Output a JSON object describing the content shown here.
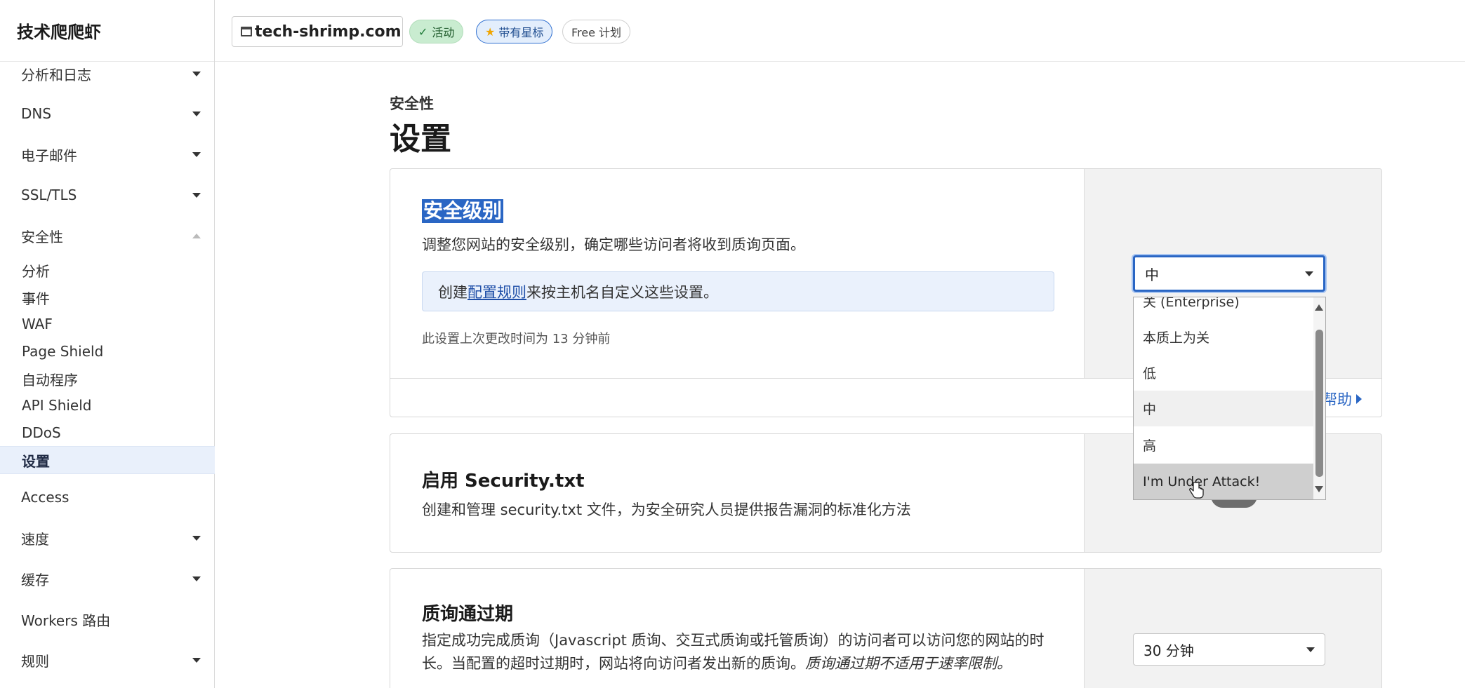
{
  "sidebar": {
    "brand": "技术爬爬虾",
    "groups": [
      {
        "label": "分析和日志",
        "expanded": false
      },
      {
        "label": "DNS",
        "expanded": false
      },
      {
        "label": "电子邮件",
        "expanded": false
      },
      {
        "label": "SSL/TLS",
        "expanded": false
      },
      {
        "label": "安全性",
        "expanded": true
      }
    ],
    "security_items": [
      "分析",
      "事件",
      "WAF",
      "Page Shield",
      "自动程序",
      "API Shield",
      "DDoS",
      "设置"
    ],
    "active_item": "设置",
    "bottom_items": [
      {
        "label": "Access",
        "has_caret": false
      },
      {
        "label": "速度",
        "has_caret": true
      },
      {
        "label": "缓存",
        "has_caret": true
      },
      {
        "label": "Workers 路由",
        "has_caret": false
      },
      {
        "label": "规则",
        "has_caret": true
      }
    ]
  },
  "topbar": {
    "domain": "tech-shrimp.com",
    "badge_active": "活动",
    "badge_starred": "带有星标",
    "badge_plan": "Free 计划"
  },
  "main": {
    "breadcrumb": "安全性",
    "title": "设置",
    "security_level": {
      "title": "安全级别",
      "description": "调整您网站的安全级别，确定哪些访问者将收到质询页面。",
      "info_prefix": "创建",
      "info_link": "配置规则",
      "info_suffix": "来按主机名自定义这些设置。",
      "meta": "此设置上次更改时间为 13 分钟前",
      "help": "帮助",
      "selected": "中",
      "options": [
        "关 (Enterprise)",
        "本质上为关",
        "低",
        "中",
        "高",
        "I'm Under Attack!"
      ],
      "hovered_option": "I'm Under Attack!"
    },
    "security_txt": {
      "title": "启用 Security.txt",
      "description": "创建和管理 security.txt 文件，为安全研究人员提供报告漏洞的标准化方法"
    },
    "challenge_passage": {
      "title": "质询通过期",
      "description": "指定成功完成质询（Javascript 质询、交互式质询或托管质询）的访问者可以访问您的网站的时长。当配置的超时过期时，网站将向访问者发出新的质询。",
      "description_italic": "质询通过期不适用于速率限制。",
      "selected": "30 分钟"
    }
  },
  "colors": {
    "accent": "#2a66c4",
    "active_badge": "#c9ecd0",
    "sidebar_active": "#e9f0fb"
  }
}
